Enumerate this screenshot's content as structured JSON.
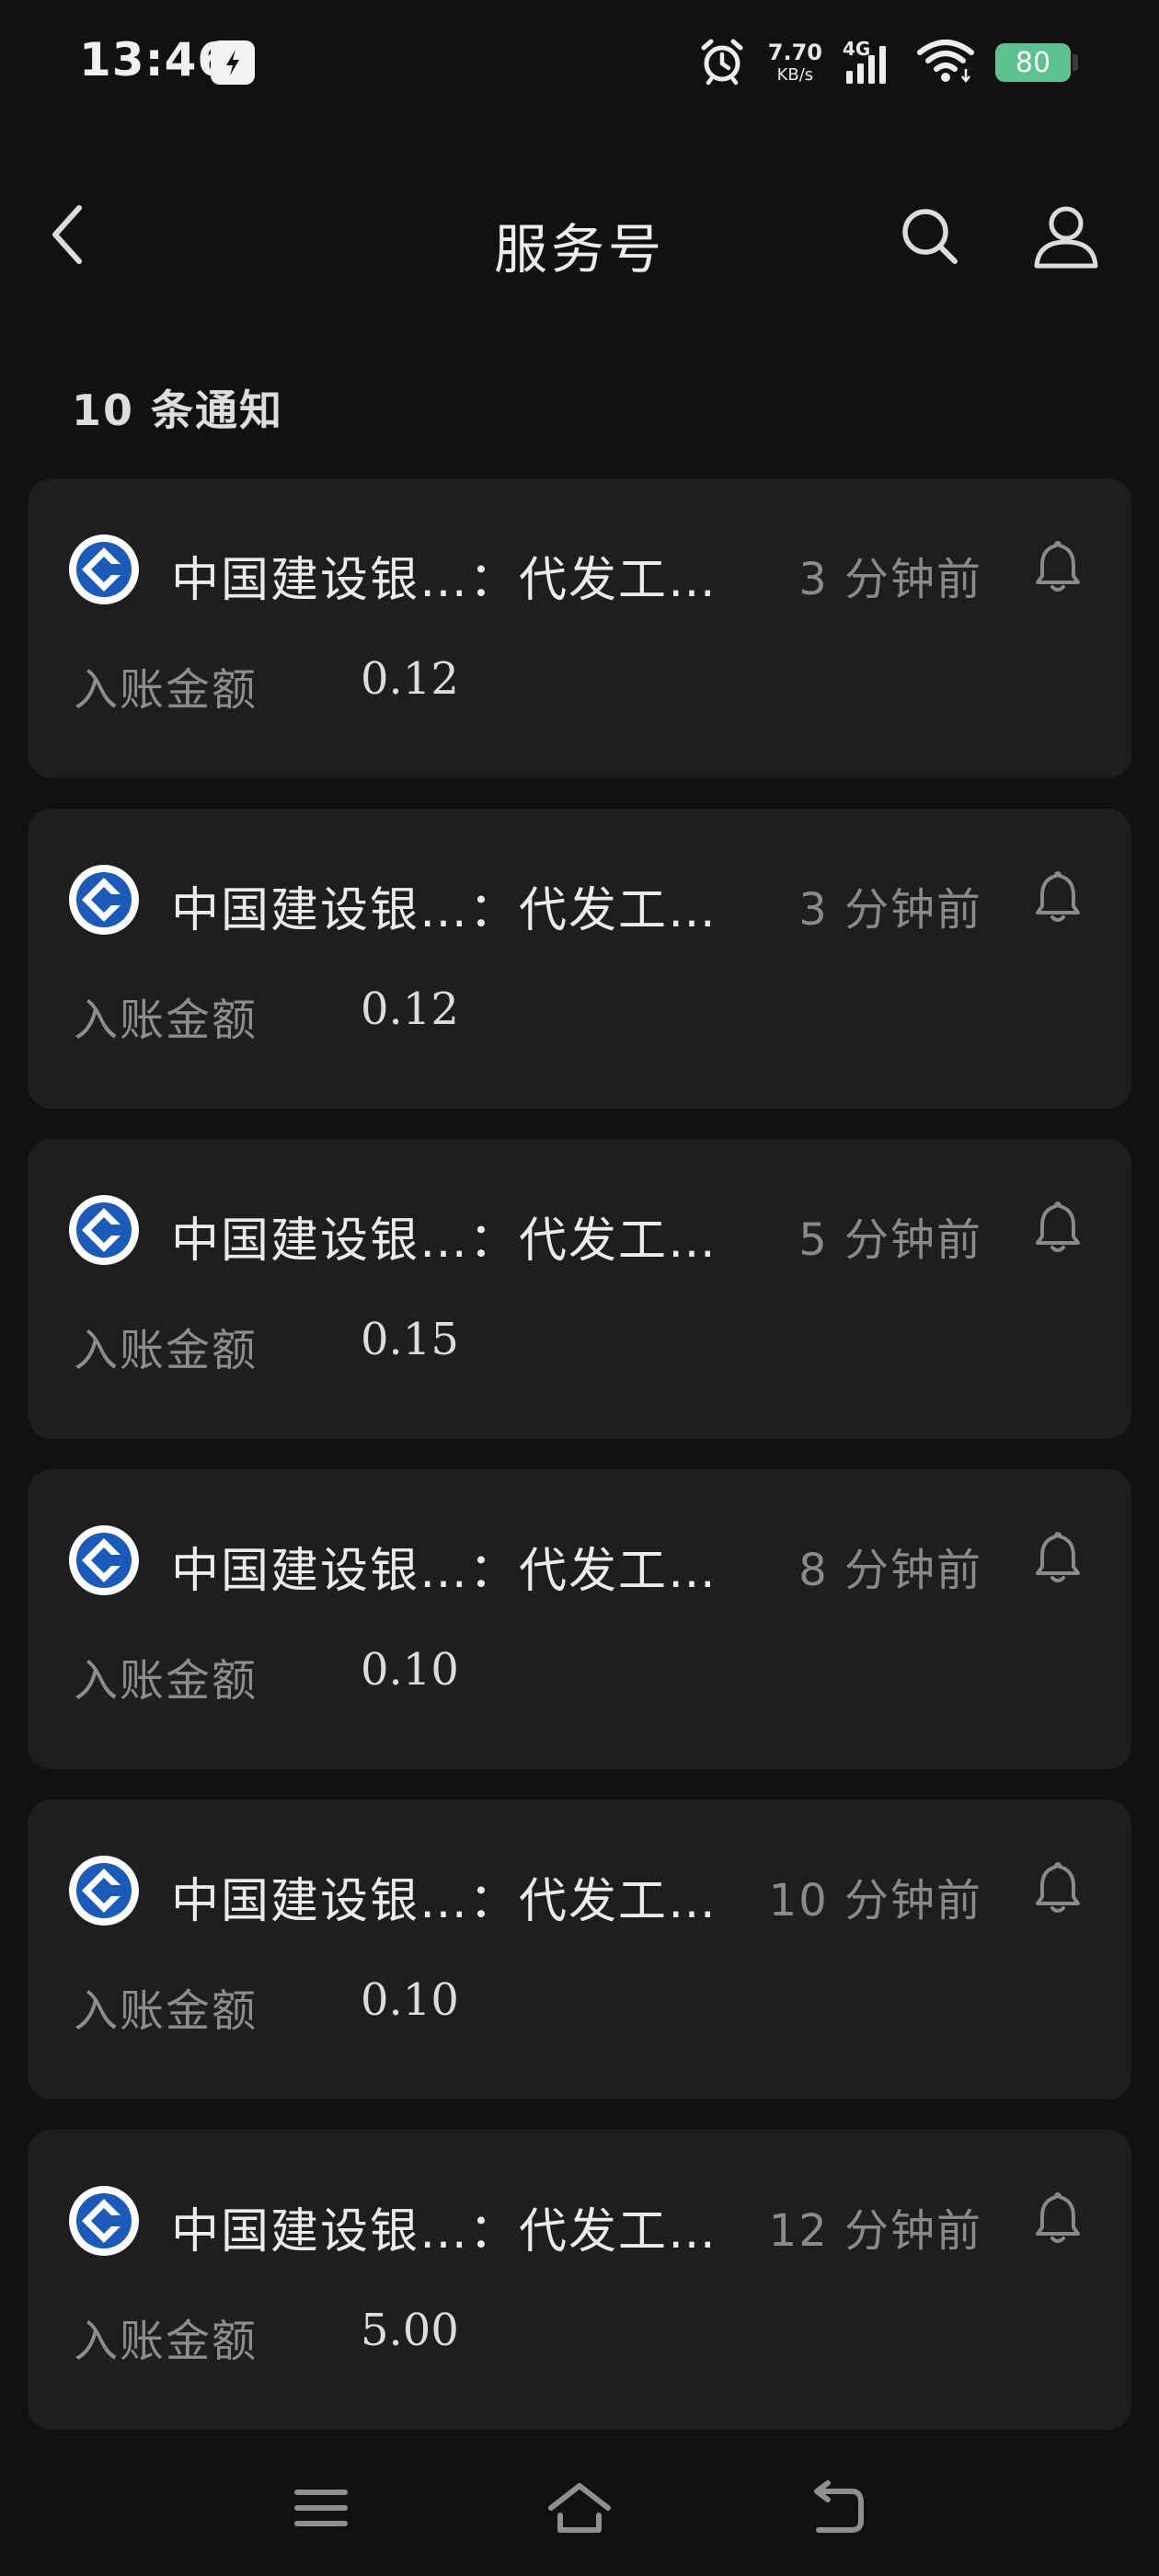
{
  "status_bar": {
    "time": "13:46",
    "net_speed_value": "7.70",
    "net_speed_unit": "KB/s",
    "network_type": "4G",
    "battery": "80"
  },
  "header": {
    "title": "服务号",
    "back_icon": "chevron-left-icon",
    "search_icon": "search-icon",
    "profile_icon": "user-icon"
  },
  "notice_count": "10 条通知",
  "cards": [
    {
      "title": "中国建设银…：代发工…",
      "time": "3 分钟前",
      "amount_label": "入账金额",
      "amount": "0.12"
    },
    {
      "title": "中国建设银…：代发工…",
      "time": "3 分钟前",
      "amount_label": "入账金额",
      "amount": "0.12"
    },
    {
      "title": "中国建设银…：代发工…",
      "time": "5 分钟前",
      "amount_label": "入账金额",
      "amount": "0.15"
    },
    {
      "title": "中国建设银…：代发工…",
      "time": "8 分钟前",
      "amount_label": "入账金额",
      "amount": "0.10"
    },
    {
      "title": "中国建设银…：代发工…",
      "time": "10 分钟前",
      "amount_label": "入账金额",
      "amount": "0.10"
    },
    {
      "title": "中国建设银…：代发工…",
      "time": "12 分钟前",
      "amount_label": "入账金额",
      "amount": "5.00"
    }
  ],
  "colors": {
    "background": "#111111",
    "card": "#1e1e1f",
    "bank_blue": "#1a5ab8",
    "battery_green": "#5ec28e"
  },
  "system_nav": {
    "menu_icon": "menu-icon",
    "home_icon": "home-icon",
    "back_icon": "back-arrow-icon"
  }
}
